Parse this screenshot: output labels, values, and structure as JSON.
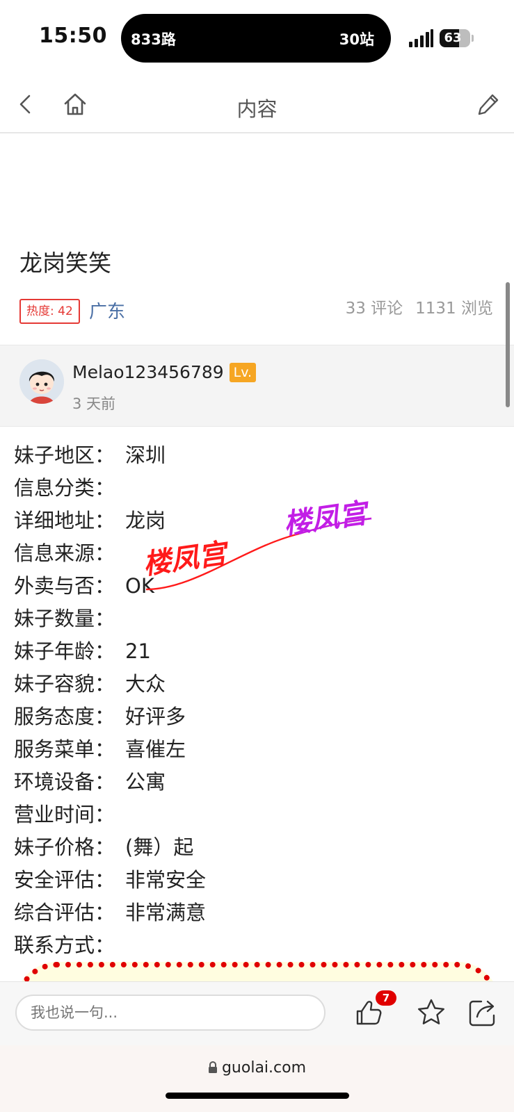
{
  "status_bar": {
    "time": "15:50",
    "island_left": "833路",
    "island_right": "30站",
    "battery": "63",
    "battery_level": 0.63
  },
  "nav": {
    "title": "内容",
    "icons": [
      "back-chevron-icon",
      "home-icon",
      "edit-pencil-icon"
    ]
  },
  "post": {
    "title": "龙岗笑笑",
    "heat_label": "热度: 42",
    "region": "广东",
    "comments": "33 评论",
    "views": "1131 浏览"
  },
  "author": {
    "username": "Melao123456789",
    "level_badge": "Lv.",
    "posted": "3 天前"
  },
  "info_rows": [
    {
      "key": "妹子地区：",
      "value": "深圳"
    },
    {
      "key": "信息分类：",
      "value": ""
    },
    {
      "key": "详细地址：",
      "value": "龙岗"
    },
    {
      "key": "信息来源：",
      "value": ""
    },
    {
      "key": "外卖与否：",
      "value": "OK"
    },
    {
      "key": "妹子数量：",
      "value": ""
    },
    {
      "key": "妹子年龄：",
      "value": "21"
    },
    {
      "key": "妹子容貌：",
      "value": "大众"
    },
    {
      "key": "服务态度：",
      "value": "好评多"
    },
    {
      "key": "服务菜单：",
      "value": "喜催左"
    },
    {
      "key": "环境设备：",
      "value": "公寓"
    },
    {
      "key": "营业时间：",
      "value": ""
    },
    {
      "key": "妹子价格：",
      "value": "(舞）起"
    },
    {
      "key": "安全评估：",
      "value": "非常安全"
    },
    {
      "key": "综合评估：",
      "value": "非常满意"
    },
    {
      "key": "联系方式：",
      "value": ""
    }
  ],
  "watermark": {
    "text_left": "楼凤宫",
    "text_right": "楼凤宫",
    "color_left": "#ff1a1a",
    "color_right": "#c21ee6"
  },
  "comment_bar": {
    "placeholder": "我也说一句...",
    "like_count": "7"
  },
  "browser": {
    "url": "guolai.com"
  },
  "colors": {
    "heat": "#e53935",
    "region_link": "#4a6fa5",
    "level_badge": "#f6a623",
    "like_badge": "#e00000"
  }
}
